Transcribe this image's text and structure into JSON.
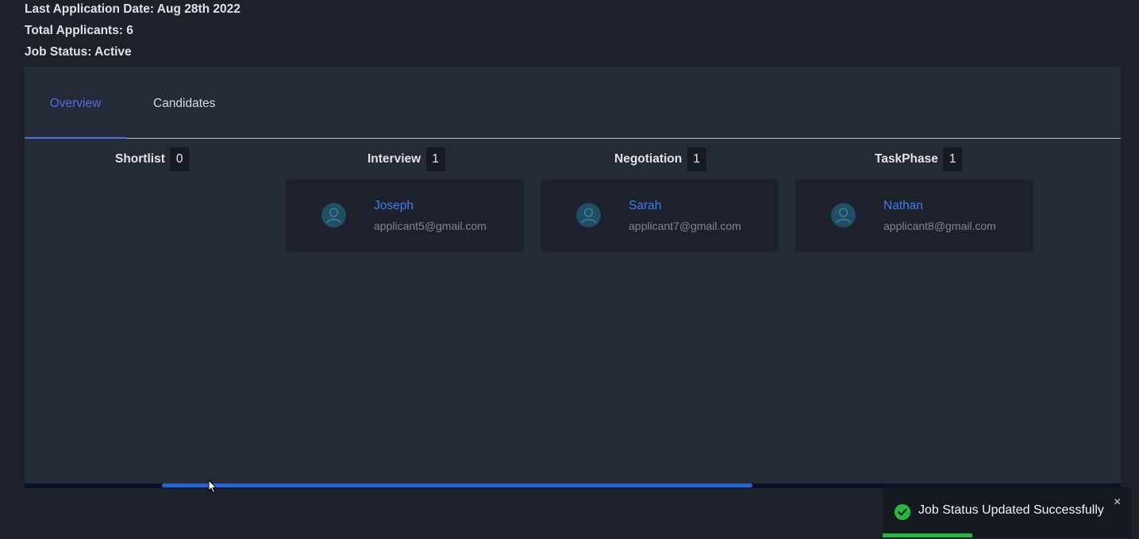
{
  "job_meta": {
    "last_application": "Last Application Date: Aug 28th 2022",
    "total_applicants": "Total Applicants: 6",
    "job_status": "Job Status: Active"
  },
  "tabs": [
    {
      "label": "Overview",
      "active": true
    },
    {
      "label": "Candidates",
      "active": false
    }
  ],
  "columns": [
    {
      "title": "Shortlist",
      "count": "0",
      "cards": []
    },
    {
      "title": "Interview",
      "count": "1",
      "cards": [
        {
          "name": "Joseph",
          "email": "applicant5@gmail.com"
        }
      ]
    },
    {
      "title": "Negotiation",
      "count": "1",
      "cards": [
        {
          "name": "Sarah",
          "email": "applicant7@gmail.com"
        }
      ]
    },
    {
      "title": "TaskPhase",
      "count": "1",
      "cards": [
        {
          "name": "Nathan",
          "email": "applicant8@gmail.com"
        }
      ]
    }
  ],
  "toast": {
    "message": "Job Status Updated Successfully",
    "close": "×",
    "progress": 0.36,
    "icon": "check-circle-icon"
  },
  "colors": {
    "accent": "#4f6fe8",
    "link": "#3f7ef2",
    "success": "#1fbd3a",
    "scrollbar": "#2364de"
  },
  "icons": {
    "avatar": "user-avatar-icon",
    "cursor": "mouse-cursor-icon"
  }
}
